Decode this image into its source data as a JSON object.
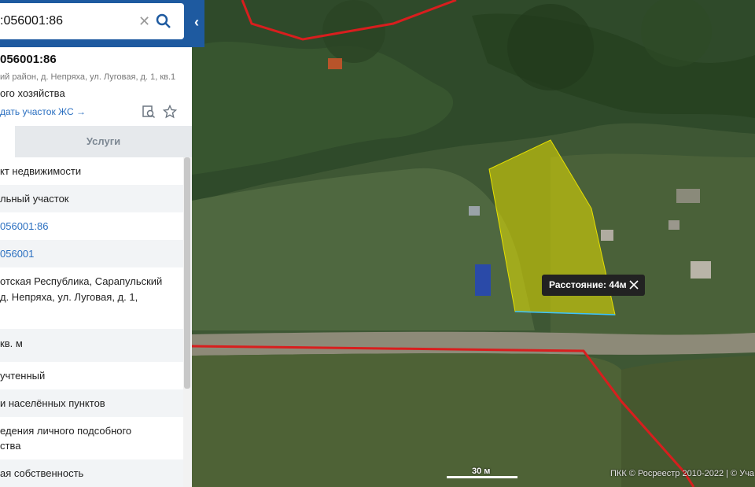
{
  "search": {
    "value": ":056001:86"
  },
  "info": {
    "title": "056001:86",
    "address": "ий район, д. Непряха, ул. Луговая, д. 1, кв.1",
    "use": "ого хозяйства",
    "link": "дать участок ЖС →"
  },
  "tabs": {
    "services": "Услуги"
  },
  "rows": [
    {
      "lines": [
        "кт недвижимости"
      ]
    },
    {
      "lines": [
        "льный участок"
      ]
    },
    {
      "lines": [
        "056001:86"
      ],
      "link": true
    },
    {
      "lines": [
        "056001"
      ],
      "link": true
    },
    {
      "lines": [
        "отская Республика, Сарапульский",
        "д. Непряха, ул. Луговая, д. 1,"
      ]
    },
    {
      "lines": [
        "кв. м"
      ]
    },
    {
      "lines": [
        "учтенный"
      ]
    },
    {
      "lines": [
        "и населённых пунктов"
      ]
    },
    {
      "lines": [
        "едения личного подсобного",
        "ства"
      ]
    },
    {
      "lines": [
        "ая собственность"
      ]
    }
  ],
  "map": {
    "measure_label": "Расстояние: 44м",
    "scale_label": "30 м",
    "attribution": "ПКК © Росреестр 2010-2022 | © Уча",
    "colors": {
      "parcel": "#e6e000",
      "boundary": "#d81e1e",
      "accent": "#1e5aa0"
    }
  }
}
